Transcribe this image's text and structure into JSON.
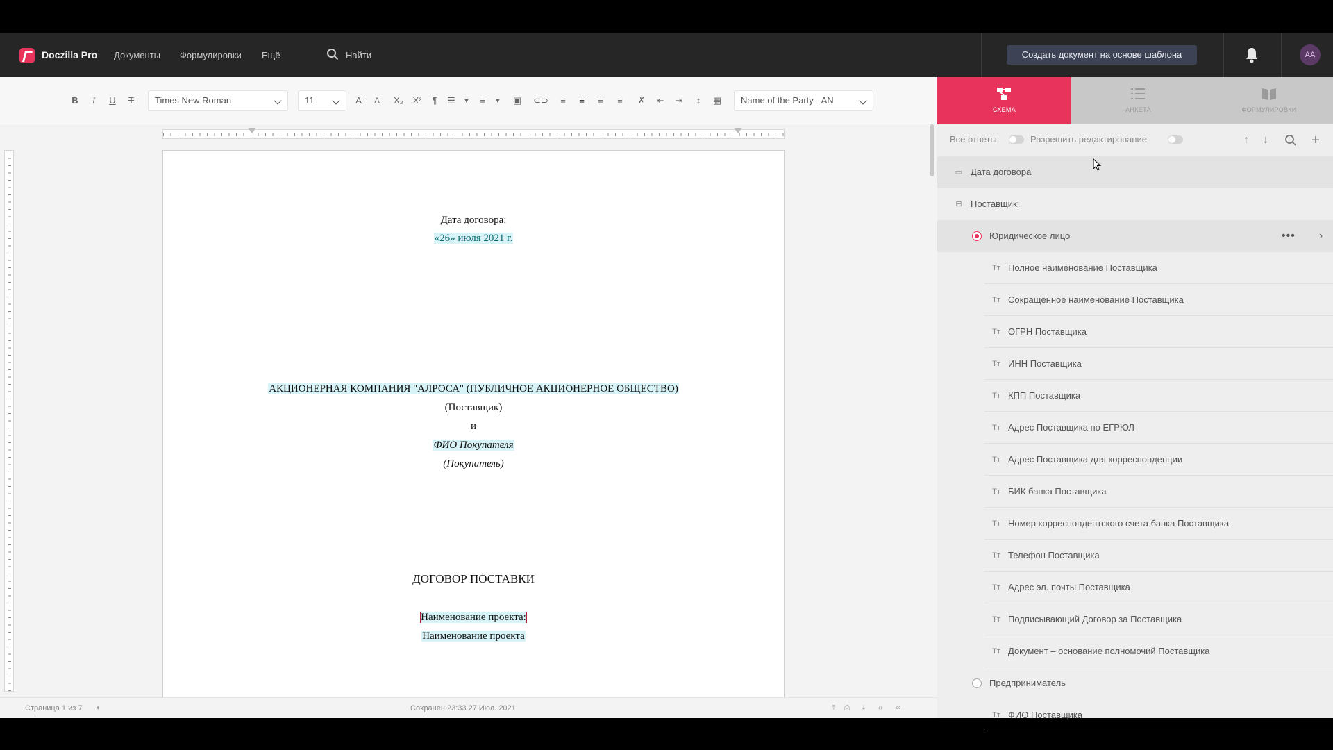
{
  "topbar": {
    "brand": "Doczilla Pro",
    "nav": [
      "Документы",
      "Формулировки",
      "Ещё"
    ],
    "search_label": "Найти",
    "create_button": "Создать документ на основе шаблона",
    "avatar": "AA"
  },
  "toolbar": {
    "font": "Times New Roman",
    "size": "11",
    "style_preset": "Name of the Party - AN"
  },
  "document": {
    "date_label": "Дата договора:",
    "date_value": "«26» июля 2021 г.",
    "party_name": "АКЦИОНЕРНАЯ КОМПАНИЯ \"АЛРОСА\" (ПУБЛИЧНОЕ АКЦИОНЕРНОЕ ОБЩЕСТВО)",
    "party_role": "(Поставщик)",
    "and": "и",
    "buyer_name": "ФИО Покупателя",
    "buyer_role": "(Покупатель)",
    "contract_title": "ДОГОВОР ПОСТАВКИ",
    "project_label": "Наименование проекта:",
    "project_value": "Наименование проекта"
  },
  "statusbar": {
    "page": "Страница 1 из 7",
    "saved": "Сохранен 23:33 27 Июл. 2021"
  },
  "panel": {
    "tabs": [
      {
        "label": "СХЕМА",
        "active": true
      },
      {
        "label": "АНКЕТА",
        "active": false
      },
      {
        "label": "ФОРМУЛИРОВКИ",
        "active": false
      }
    ],
    "all_answers": "Все ответы",
    "allow_edit": "Разрешить редактирование",
    "rows": [
      {
        "label": "Дата договора",
        "icon": "calendar-icon",
        "kind": "field"
      },
      {
        "label": "Поставщик:",
        "icon": "group-icon",
        "kind": "group"
      },
      {
        "label": "Юридическое лицо",
        "kind": "radio",
        "checked": true
      },
      {
        "label": "Полное наименование Поставщика",
        "icon": "text-field-icon",
        "kind": "text"
      },
      {
        "label": "Сокращённое наименование Поставщика",
        "icon": "text-field-icon",
        "kind": "text"
      },
      {
        "label": "ОГРН Поставщика",
        "icon": "text-field-icon",
        "kind": "text"
      },
      {
        "label": "ИНН Поставщика",
        "icon": "text-field-icon",
        "kind": "text"
      },
      {
        "label": "КПП Поставщика",
        "icon": "text-field-icon",
        "kind": "text"
      },
      {
        "label": "Адрес Поставщика по ЕГРЮЛ",
        "icon": "text-field-icon",
        "kind": "text"
      },
      {
        "label": "Адрес Поставщика для корреспонденции",
        "icon": "text-field-icon",
        "kind": "text"
      },
      {
        "label": "БИК банка Поставщика",
        "icon": "text-field-icon",
        "kind": "text"
      },
      {
        "label": "Номер корреспондентского счета банка Поставщика",
        "icon": "text-field-icon",
        "kind": "text"
      },
      {
        "label": "Телефон Поставщика",
        "icon": "text-field-icon",
        "kind": "text"
      },
      {
        "label": "Адрес эл. почты Поставщика",
        "icon": "text-field-icon",
        "kind": "text"
      },
      {
        "label": "Подписывающий Договор за Поставщика",
        "icon": "text-field-icon",
        "kind": "text"
      },
      {
        "label": "Документ – основание полномочий Поставщика",
        "icon": "text-field-icon",
        "kind": "text"
      },
      {
        "label": "Предприниматель",
        "kind": "radio",
        "checked": false
      },
      {
        "label": "ФИО Поставщика",
        "icon": "text-field-icon",
        "kind": "text"
      }
    ]
  },
  "colors": {
    "accent": "#e8335c",
    "topbar_bg": "#262626",
    "highlight": "#d8f3f7"
  }
}
